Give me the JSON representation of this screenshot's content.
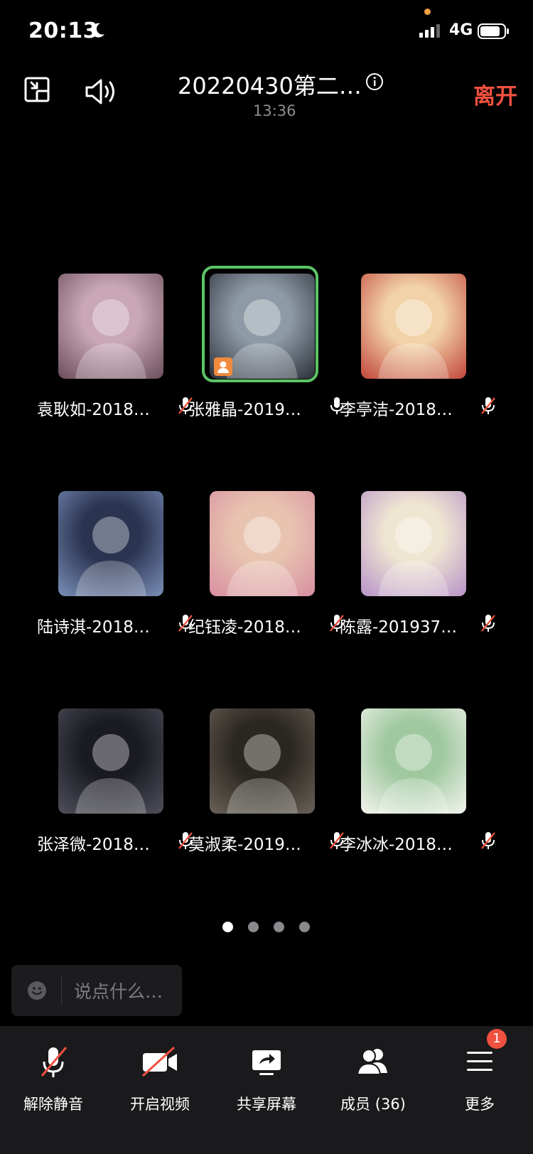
{
  "status_bar": {
    "time": "20:13",
    "network": "4G"
  },
  "header": {
    "title": "20220430第二…",
    "timer": "13:36",
    "leave_label": "离开"
  },
  "participants": [
    {
      "name": "袁耿如-2018…",
      "mic": "muted",
      "active": false,
      "host": false
    },
    {
      "name": "张雅晶-2019…",
      "mic": "on",
      "active": true,
      "host": true
    },
    {
      "name": "李亭洁-2018…",
      "mic": "muted",
      "active": false,
      "host": false
    },
    {
      "name": "陆诗淇-2018…",
      "mic": "muted",
      "active": false,
      "host": false
    },
    {
      "name": "纪钰凌-2018…",
      "mic": "muted",
      "active": false,
      "host": false
    },
    {
      "name": "陈露-201937…",
      "mic": "muted",
      "active": false,
      "host": false
    },
    {
      "name": "张泽微-2018…",
      "mic": "muted",
      "active": false,
      "host": false
    },
    {
      "name": "莫淑柔-2019…",
      "mic": "muted",
      "active": false,
      "host": false
    },
    {
      "name": "李冰冰-2018…",
      "mic": "muted",
      "active": false,
      "host": false
    }
  ],
  "pager": {
    "pages": 4,
    "current": 1
  },
  "chat": {
    "placeholder": "说点什么…"
  },
  "toolbar": {
    "unmute_label": "解除静音",
    "video_label": "开启视频",
    "share_label": "共享屏幕",
    "members_label": "成员 (36)",
    "more_label": "更多",
    "more_badge": "1"
  },
  "colors": {
    "accent_red": "#f0513f",
    "active_green": "#5cc467"
  }
}
